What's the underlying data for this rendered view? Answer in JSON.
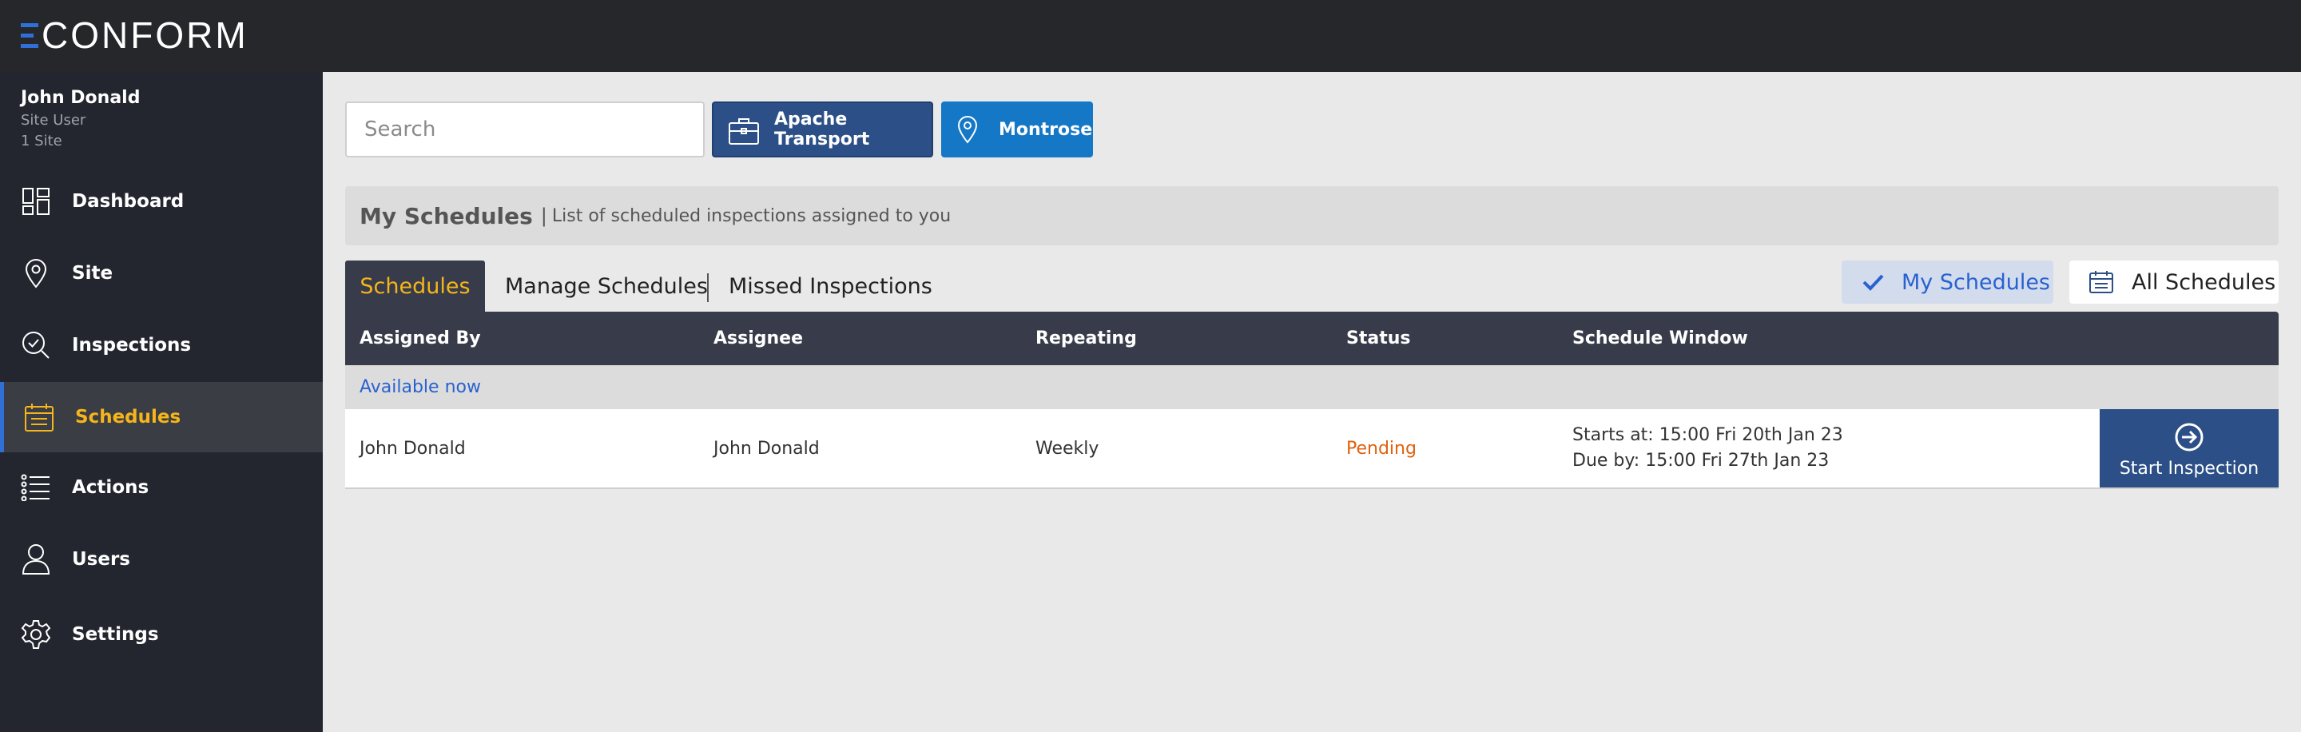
{
  "app": {
    "logo_text": "CONFORM"
  },
  "user": {
    "name": "John Donald",
    "role": "Site User",
    "sites": "1 Site"
  },
  "sidebar": {
    "items": [
      {
        "label": "Dashboard",
        "icon": "dashboard-icon"
      },
      {
        "label": "Site",
        "icon": "location-pin-icon"
      },
      {
        "label": "Inspections",
        "icon": "inspection-search-icon"
      },
      {
        "label": "Schedules",
        "icon": "calendar-icon",
        "active": true
      },
      {
        "label": "Actions",
        "icon": "list-icon"
      },
      {
        "label": "Users",
        "icon": "user-icon"
      },
      {
        "label": "Settings",
        "icon": "gear-icon"
      }
    ]
  },
  "search": {
    "placeholder": "Search",
    "value": ""
  },
  "filters_bar": {
    "company": "Apache Transport",
    "site": "Montrose"
  },
  "header": {
    "title": "My Schedules",
    "separator": "|",
    "subtitle": "List of scheduled inspections assigned to you"
  },
  "tabs": [
    {
      "label": "Schedules",
      "active": true
    },
    {
      "label": "Manage Schedules"
    },
    {
      "label": "Missed Inspections"
    }
  ],
  "view_filters": {
    "my": "My Schedules",
    "all": "All Schedules",
    "selected": "My Schedules"
  },
  "table": {
    "columns": [
      "Assigned By",
      "Assignee",
      "Repeating",
      "Status",
      "Schedule Window"
    ],
    "group_label": "Available now",
    "rows": [
      {
        "assigned_by": "John Donald",
        "assignee": "John Donald",
        "repeating": "Weekly",
        "status": "Pending",
        "starts": "Starts at: 15:00 Fri 20th Jan 23",
        "due": "Due by: 15:00 Fri 27th Jan 23",
        "action": "Start Inspection"
      }
    ]
  },
  "colors": {
    "accent": "#2961d0",
    "active_nav": "#f5b51b",
    "pending": "#e0620e",
    "header_dark": "#383c4a"
  }
}
